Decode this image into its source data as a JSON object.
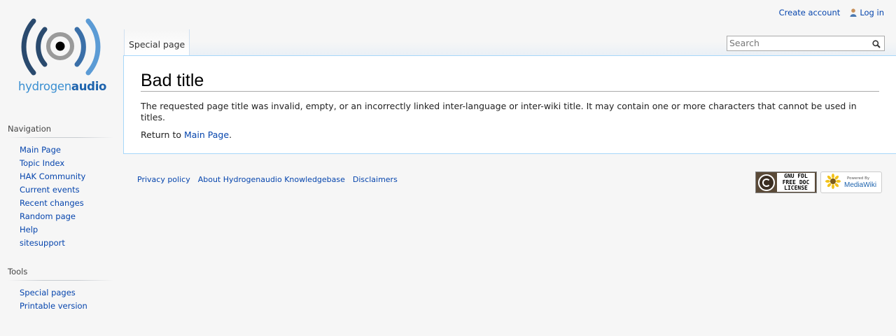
{
  "logo": {
    "word_light": "hydrogen",
    "word_bold": "audio",
    "colors": {
      "inner": "#9a9a9a",
      "middle": "#2a4a6e",
      "outer": "#3a6fa8",
      "dot": "#000000"
    }
  },
  "personal": {
    "create_account": "Create account",
    "log_in": "Log in"
  },
  "tabs": {
    "special_page": "Special page"
  },
  "search": {
    "placeholder": "Search"
  },
  "content": {
    "title": "Bad title",
    "body": "The requested page title was invalid, empty, or an incorrectly linked inter-language or inter-wiki title. It may contain one or more characters that cannot be used in titles.",
    "return_prefix": "Return to ",
    "return_link": "Main Page",
    "return_suffix": "."
  },
  "sidebar": {
    "navigation": {
      "heading": "Navigation",
      "items": [
        {
          "label": "Main Page"
        },
        {
          "label": "Topic Index"
        },
        {
          "label": "HAK Community"
        },
        {
          "label": "Current events"
        },
        {
          "label": "Recent changes"
        },
        {
          "label": "Random page"
        },
        {
          "label": "Help"
        },
        {
          "label": "sitesupport"
        }
      ]
    },
    "tools": {
      "heading": "Tools",
      "items": [
        {
          "label": "Special pages"
        },
        {
          "label": "Printable version"
        }
      ]
    }
  },
  "footer": {
    "links": [
      {
        "label": "Privacy policy"
      },
      {
        "label": "About Hydrogenaudio Knowledgebase"
      },
      {
        "label": "Disclaimers"
      }
    ],
    "badges": {
      "gfdl_line1": "GNU FDL",
      "gfdl_line2": "FREE DOC",
      "gfdl_line3": "LICENSE",
      "mw_small": "Powered By",
      "mw_name": "MediaWiki"
    }
  },
  "colors": {
    "link": "#0645ad",
    "content_border": "#a7d7f9",
    "page_background": "#f6f6f6"
  }
}
